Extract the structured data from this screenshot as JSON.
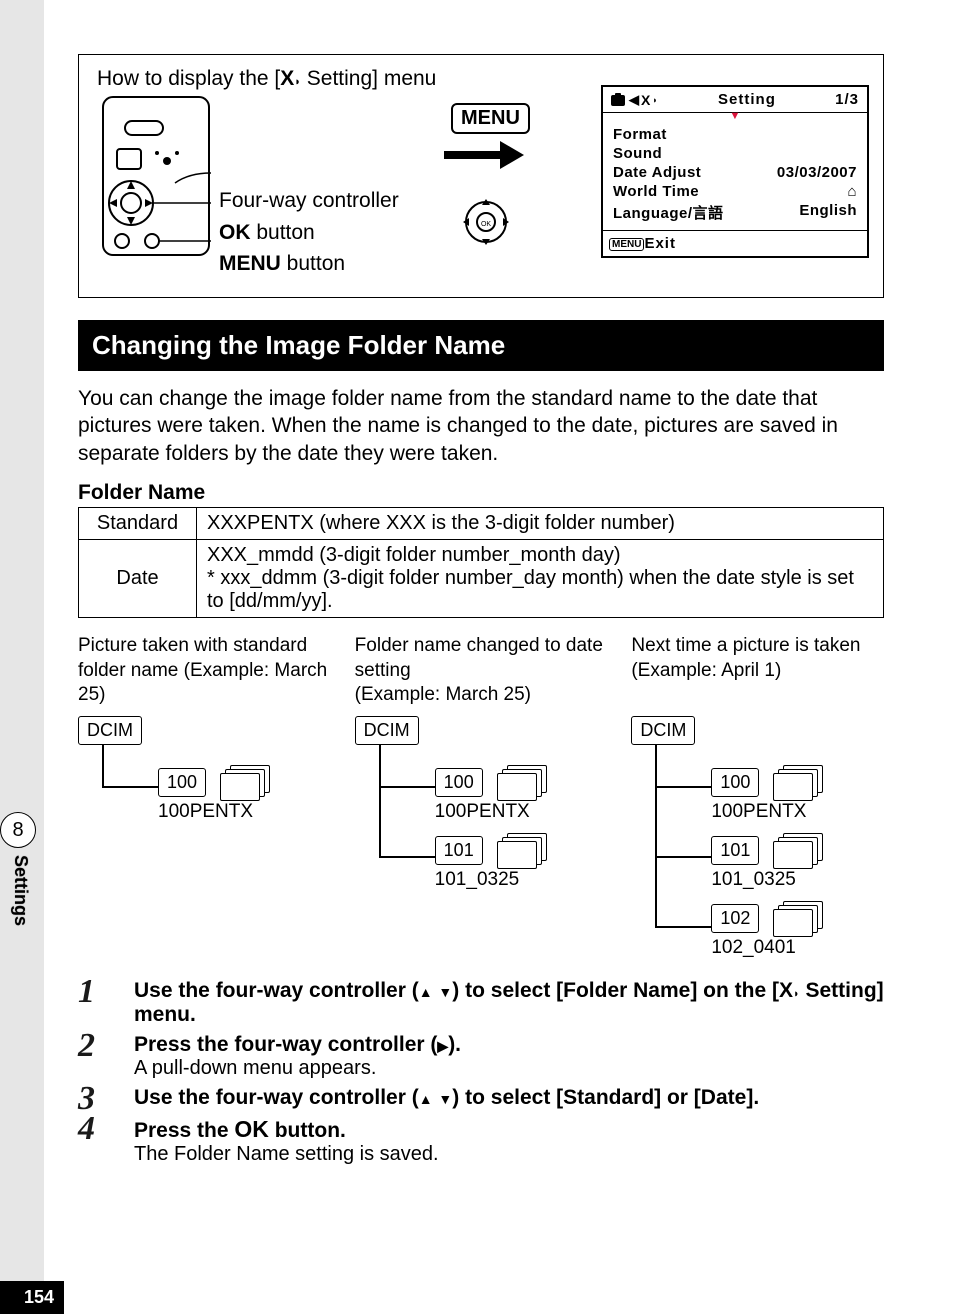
{
  "page_number": "154",
  "chapter_number": "8",
  "chapter_label": "Settings",
  "howto": {
    "title_pre": "How to display the [",
    "title_post": " Setting] menu",
    "fourway": "Four-way controller",
    "okbold": "OK",
    "okrest": " button",
    "menubold": "MENU",
    "menurest": " button",
    "badge": "MENU"
  },
  "screen": {
    "head_title": "Setting",
    "head_page": "1/3",
    "rows": [
      {
        "l": "Format",
        "r": ""
      },
      {
        "l": "Sound",
        "r": ""
      },
      {
        "l": "Date Adjust",
        "r": "03/03/2007"
      },
      {
        "l": "World Time",
        "r": "⌂"
      },
      {
        "l": "Language/言語",
        "r": "English"
      }
    ],
    "foot_badge": "MENU",
    "foot_text": "Exit"
  },
  "main_title": "Changing the Image Folder Name",
  "intro": "You can change the image folder name from the standard name to the date that pictures were taken. When the name is changed to the date, pictures are saved in separate folders by the date they were taken.",
  "table_title": "Folder Name",
  "table": {
    "r1k": "Standard",
    "r1v": "XXXPENTX (where XXX is the 3-digit folder number)",
    "r2k": "Date",
    "r2v": "XXX_mmdd (3-digit folder number_month day)\n*  xxx_ddmm (3-digit folder number_day month) when the date style is set to [dd/mm/yy]."
  },
  "trees": {
    "col1": {
      "title": "Picture taken with standard folder name (Example: March 25)",
      "root": "DCIM",
      "n1": "100",
      "n1b": "100PENTX"
    },
    "col2": {
      "title": "Folder name changed to date setting\n(Example: March 25)",
      "root": "DCIM",
      "n1": "100",
      "n1b": "100PENTX",
      "n2": "101",
      "n2b": "101_0325"
    },
    "col3": {
      "title": "Next time a picture is taken\n(Example: April 1)",
      "root": "DCIM",
      "n1": "100",
      "n1b": "100PENTX",
      "n2": "101",
      "n2b": "101_0325",
      "n3": "102",
      "n3b": "102_0401"
    }
  },
  "steps": {
    "s1a": "Use the four-way controller (",
    "s1b": ") to select [Folder Name] on the [",
    "s1c": " Setting] menu.",
    "s2a": "Press the four-way controller (",
    "s2b": ").",
    "s2note": "A pull-down menu appears.",
    "s3a": "Use the four-way controller (",
    "s3b": ") to select [Standard] or [Date].",
    "s4a": "Press the ",
    "s4b": " button.",
    "s4ok": "OK",
    "s4note": "The Folder Name setting is saved."
  }
}
